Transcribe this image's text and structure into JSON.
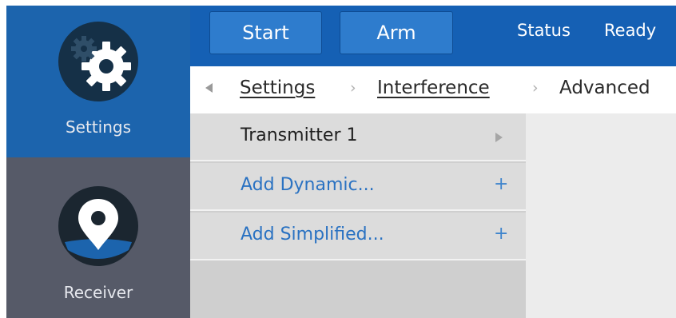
{
  "sidebar": {
    "items": [
      {
        "label": "Settings",
        "icon": "gear-icon",
        "active": true
      },
      {
        "label": "Receiver",
        "icon": "location-pin-icon",
        "active": false
      }
    ]
  },
  "toolbar": {
    "start_label": "Start",
    "arm_label": "Arm",
    "status_label": "Status",
    "status_value": "Ready"
  },
  "breadcrumb": {
    "items": [
      "Settings",
      "Interference",
      "Advanced"
    ]
  },
  "list": {
    "items": [
      {
        "label": "Transmitter 1",
        "action": "chevron-right-icon"
      },
      {
        "label": "Add Dynamic...",
        "action": "plus-icon"
      },
      {
        "label": "Add Simplified...",
        "action": "plus-icon"
      }
    ]
  },
  "colors": {
    "sidebar_active": "#1c64ad",
    "sidebar_bg": "#565a68",
    "toolbar_bg": "#1560b4",
    "button_bg": "#2e7ccd",
    "link_blue": "#2a72c2"
  }
}
